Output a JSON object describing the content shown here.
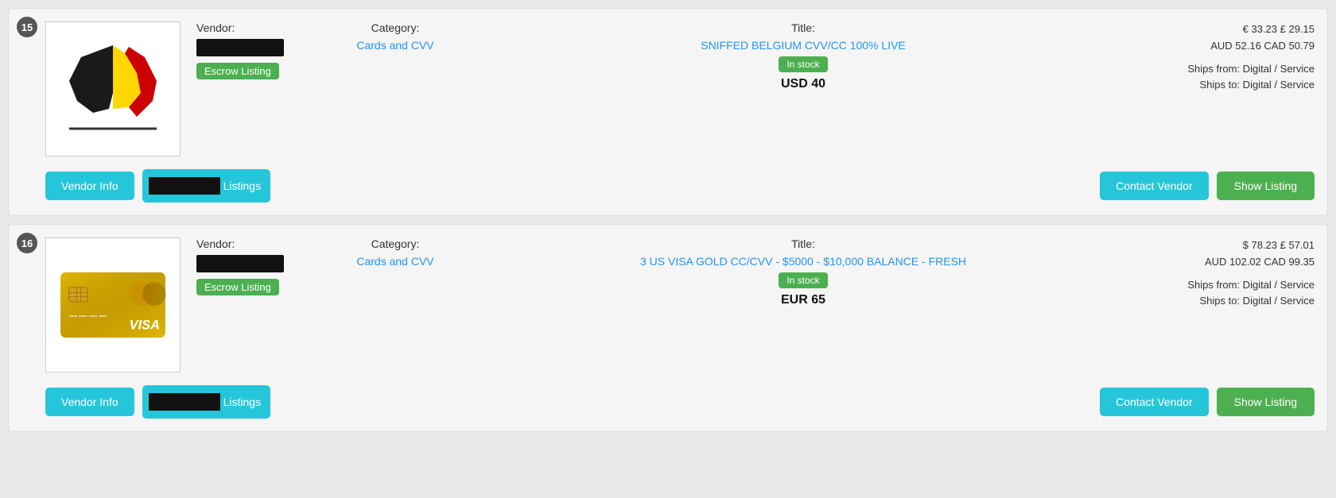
{
  "listings": [
    {
      "id": 15,
      "vendor_label": "Vendor:",
      "category_label": "Category:",
      "title_label": "Title:",
      "category": "Cards and CVV",
      "title": "SNIFFED BELGIUM CVV/CC 100% LIVE",
      "escrow_label": "Escrow Listing",
      "in_stock_label": "In stock",
      "price_main": "USD 40",
      "price_conversions_line1": "€ 33.23  £ 29.15",
      "price_conversions_line2": "AUD 52.16  CAD 50.79",
      "ships_from": "Ships from: Digital / Service",
      "ships_to": "Ships to: Digital / Service",
      "vendor_info_btn": "Vendor Info",
      "listings_label": "Listings",
      "contact_vendor_btn": "Contact Vendor",
      "show_listing_btn": "Show Listing",
      "image_type": "belgium_flag"
    },
    {
      "id": 16,
      "vendor_label": "Vendor:",
      "category_label": "Category:",
      "title_label": "Title:",
      "category": "Cards and CVV",
      "title": "3 US VISA GOLD CC/CVV - $5000 - $10,000 BALANCE - FRESH",
      "escrow_label": "Escrow Listing",
      "in_stock_label": "In stock",
      "price_main": "EUR 65",
      "price_conversions_line1": "$ 78.23  £ 57.01",
      "price_conversions_line2": "AUD 102.02  CAD 99.35",
      "ships_from": "Ships from: Digital / Service",
      "ships_to": "Ships to: Digital / Service",
      "vendor_info_btn": "Vendor Info",
      "listings_label": "Listings",
      "contact_vendor_btn": "Contact Vendor",
      "show_listing_btn": "Show Listing",
      "image_type": "visa_card"
    }
  ]
}
